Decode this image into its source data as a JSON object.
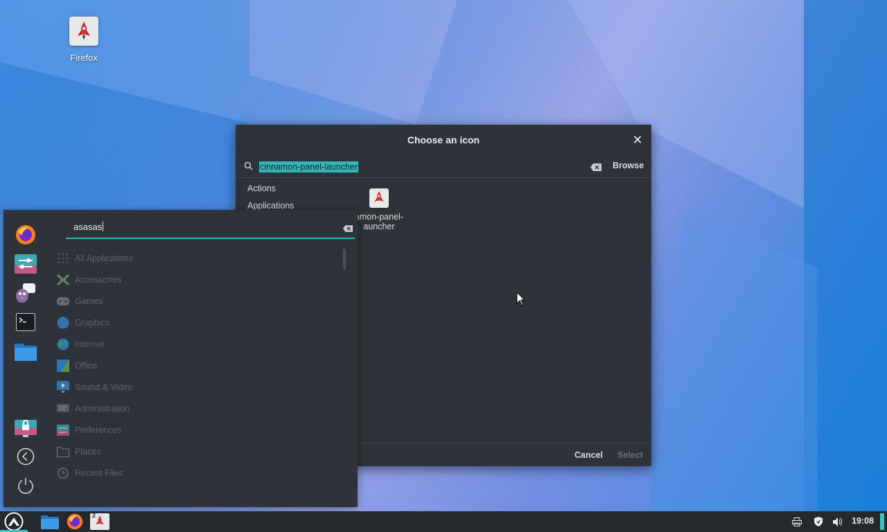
{
  "desktop": {
    "icons": [
      {
        "label": "Firefox",
        "icon": "firefox-launcher-icon"
      }
    ]
  },
  "dialog": {
    "title": "Choose an icon",
    "search_value": "cinnamon-panel-launcher",
    "browse_label": "Browse",
    "categories": [
      "Actions",
      "Applications"
    ],
    "result": {
      "line1": "amon-panel-",
      "line2": "auncher"
    },
    "cancel_label": "Cancel",
    "select_label": "Select"
  },
  "menu": {
    "search_value": "asasas",
    "favorites": [
      "firefox-icon",
      "settings-icon",
      "pidgin-icon",
      "terminal-icon",
      "files-icon"
    ],
    "session": [
      "lock-screen-icon",
      "logout-icon",
      "power-icon"
    ],
    "categories": [
      "All Applications",
      "Accessories",
      "Games",
      "Graphics",
      "Internet",
      "Office",
      "Sound & Video",
      "Administration",
      "Preferences",
      "Places",
      "Recent Files"
    ]
  },
  "taskbar": {
    "clock": "19:08",
    "window_count": "2",
    "tray": [
      "printer-icon",
      "shield-icon",
      "volume-icon"
    ]
  },
  "colors": {
    "accent": "#33b6b8",
    "panel": "#2d3338",
    "taskbar": "#24292d"
  }
}
